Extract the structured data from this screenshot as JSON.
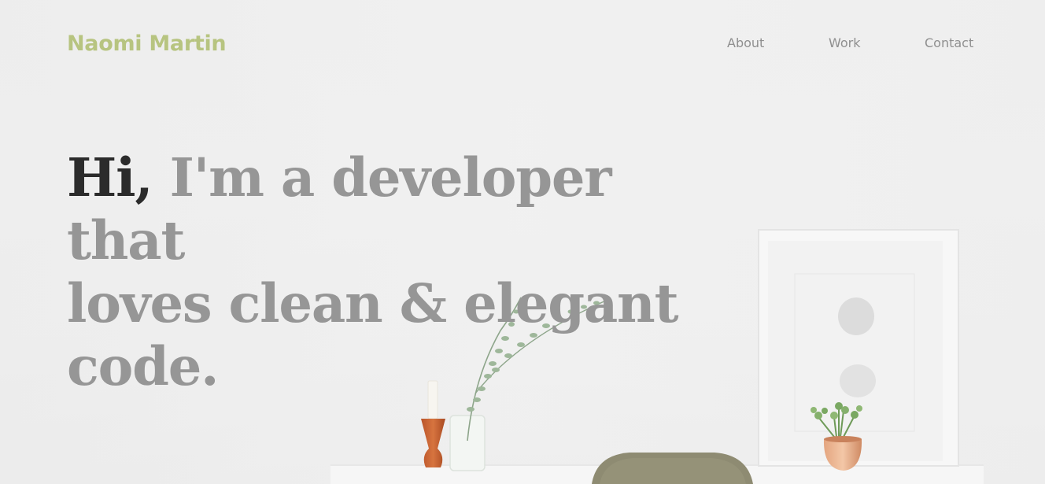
{
  "header": {
    "brand": "Naomi Martin",
    "nav": [
      {
        "label": "About"
      },
      {
        "label": "Work"
      },
      {
        "label": "Contact"
      }
    ]
  },
  "hero": {
    "greeting": "Hi",
    "comma": ",",
    "line1_rest": " I'm a developer that",
    "line2": "loves clean & elegant",
    "line3": "code."
  },
  "colors": {
    "brand": "#b7c480",
    "nav": "#8f8f8f",
    "greeting": "#2b2b2b",
    "headline": "#969696",
    "background": "#efefef"
  },
  "icons": [
    "candle-image",
    "plant-vase-image",
    "picture-frame-image",
    "potted-plant-image",
    "chair-image"
  ]
}
